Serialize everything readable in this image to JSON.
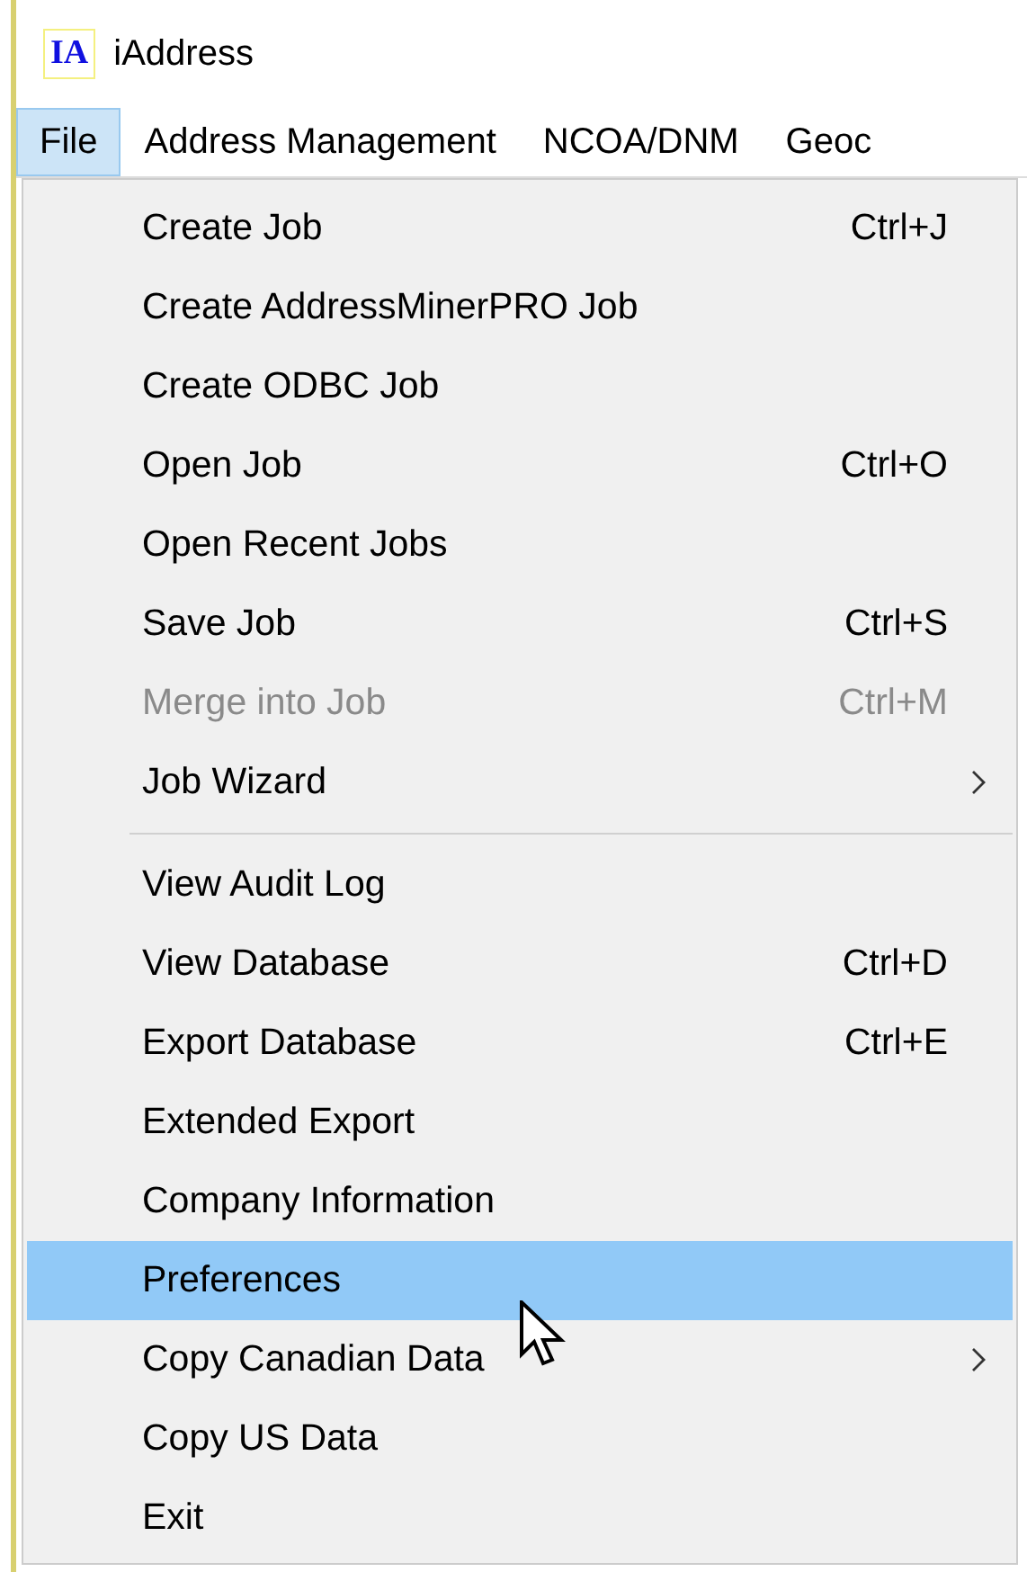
{
  "window": {
    "title": "iAddress",
    "logo": "IA"
  },
  "menu_bar": [
    {
      "label": "File",
      "selected": true
    },
    {
      "label": "Address Management",
      "selected": false
    },
    {
      "label": "NCOA/DNM",
      "selected": false
    },
    {
      "label": "Geoc",
      "selected": false
    }
  ],
  "menu_groups": [
    [
      {
        "label": "Create Job",
        "shortcut": "Ctrl+J",
        "disabled": false,
        "submenu": false,
        "selected": false
      },
      {
        "label": "Create AddressMinerPRO Job",
        "disabled": false,
        "submenu": false,
        "selected": false
      },
      {
        "label": "Create ODBC Job",
        "disabled": false,
        "submenu": false,
        "selected": false
      },
      {
        "label": "Open Job",
        "shortcut": "Ctrl+O",
        "disabled": false,
        "submenu": false,
        "selected": false
      },
      {
        "label": "Open Recent Jobs",
        "disabled": false,
        "submenu": false,
        "selected": false
      },
      {
        "label": "Save Job",
        "shortcut": "Ctrl+S",
        "disabled": false,
        "submenu": false,
        "selected": false
      },
      {
        "label": "Merge into Job",
        "shortcut": "Ctrl+M",
        "disabled": true,
        "submenu": false,
        "selected": false
      },
      {
        "label": "Job Wizard",
        "disabled": false,
        "submenu": true,
        "selected": false
      }
    ],
    [
      {
        "label": "View Audit Log",
        "disabled": false,
        "submenu": false,
        "selected": false
      },
      {
        "label": "View Database",
        "shortcut": "Ctrl+D",
        "disabled": false,
        "submenu": false,
        "selected": false
      },
      {
        "label": "Export Database",
        "shortcut": "Ctrl+E",
        "disabled": false,
        "submenu": false,
        "selected": false
      },
      {
        "label": "Extended Export",
        "disabled": false,
        "submenu": false,
        "selected": false
      },
      {
        "label": "Company Information",
        "disabled": false,
        "submenu": false,
        "selected": false
      },
      {
        "label": "Preferences",
        "disabled": false,
        "submenu": false,
        "selected": true
      },
      {
        "label": "Copy Canadian Data",
        "disabled": false,
        "submenu": true,
        "selected": false
      },
      {
        "label": "Copy US Data",
        "disabled": false,
        "submenu": false,
        "selected": false
      },
      {
        "label": "Exit",
        "disabled": false,
        "submenu": false,
        "selected": false
      }
    ]
  ]
}
